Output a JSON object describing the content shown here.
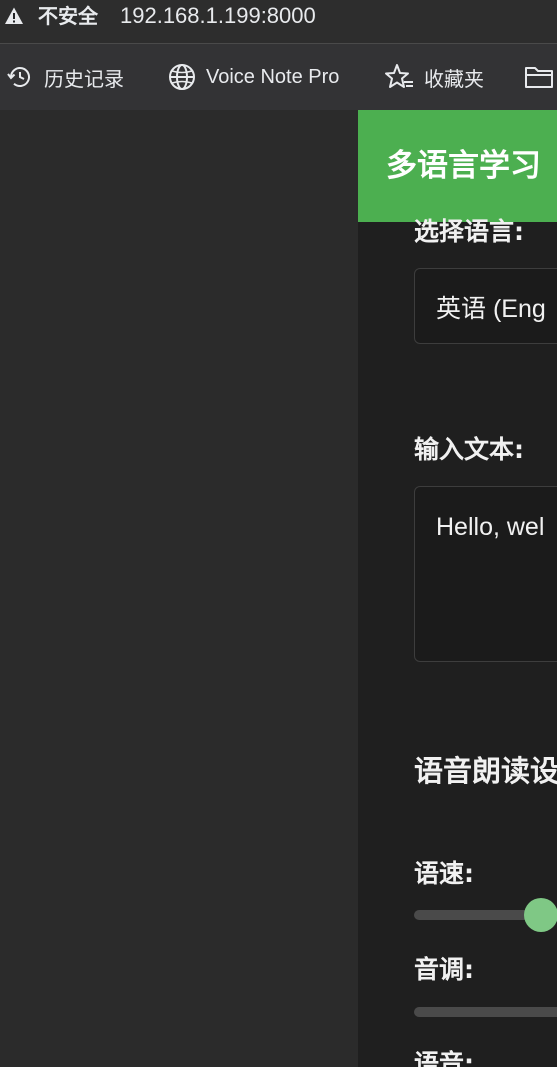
{
  "browser": {
    "security_label": "不安全",
    "url": "192.168.1.199:8000"
  },
  "bookmarks": [
    {
      "label": "历史记录",
      "icon": "history-icon"
    },
    {
      "label": "Voice Note Pro",
      "icon": "globe-icon"
    },
    {
      "label": "收藏夹",
      "icon": "favorites-star-icon"
    },
    {
      "label": "",
      "icon": "folder-icon"
    }
  ],
  "app": {
    "title": "多语言学习",
    "accent_color": "#4caf50",
    "language_label": "选择语言:",
    "language_selected": "英语 (Eng",
    "text_label": "输入文本:",
    "text_value": "Hello, wel",
    "speech_section_title": "语音朗读设",
    "rate_label": "语速:",
    "rate_value_fraction": 0.49,
    "pitch_label": "音调:",
    "voice_label": "语音:"
  }
}
